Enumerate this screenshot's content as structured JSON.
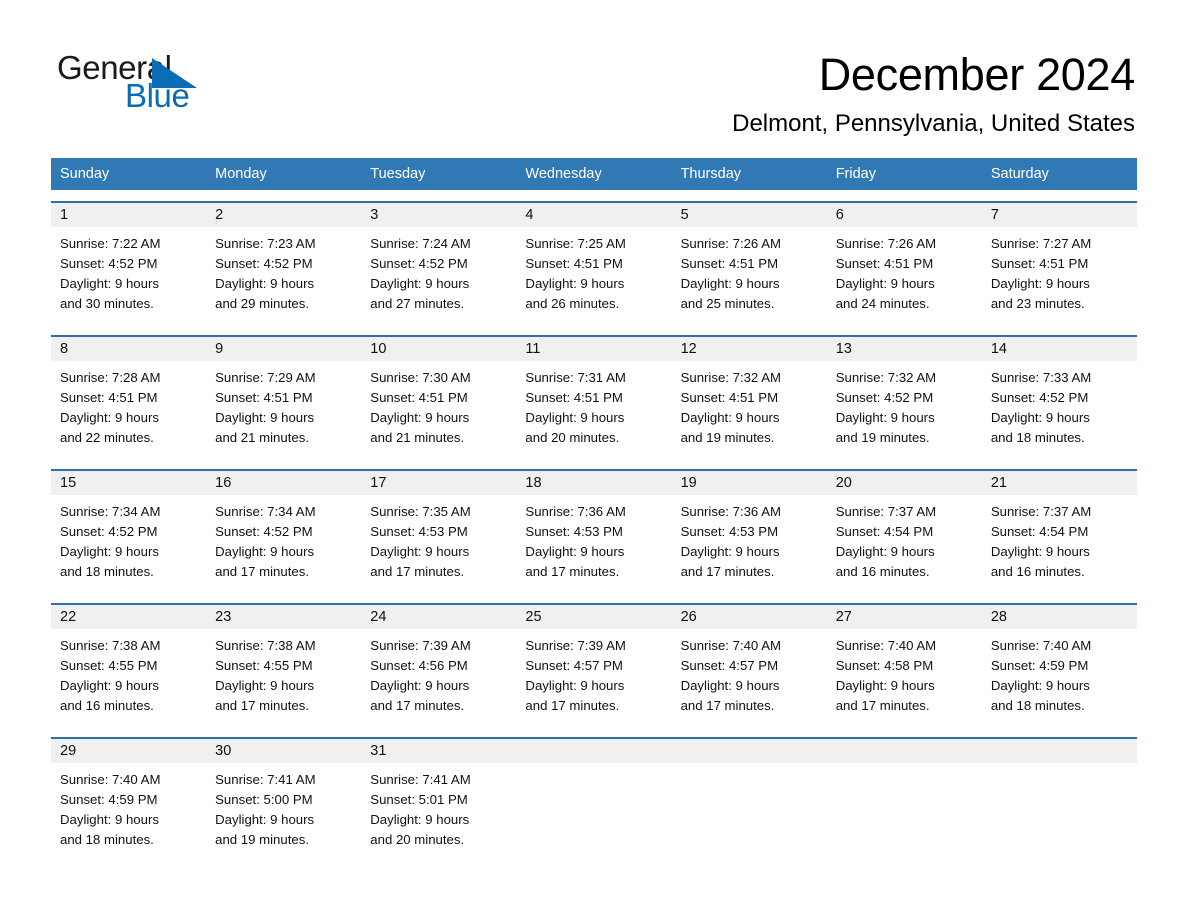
{
  "logo": {
    "word_top": "General",
    "word_bottom": "Blue",
    "triangle_color": "#0a6cb4"
  },
  "header": {
    "month_title": "December 2024",
    "location": "Delmont, Pennsylvania, United States"
  },
  "theme": {
    "header_blue": "#3179b5",
    "row_rule_blue": "#2f6fad",
    "date_band_gray": "#f0f0f0"
  },
  "weekdays": [
    "Sunday",
    "Monday",
    "Tuesday",
    "Wednesday",
    "Thursday",
    "Friday",
    "Saturday"
  ],
  "weeks": [
    {
      "days": [
        {
          "num": "1",
          "sunrise": "Sunrise: 7:22 AM",
          "sunset": "Sunset: 4:52 PM",
          "daylight1": "Daylight: 9 hours",
          "daylight2": "and 30 minutes."
        },
        {
          "num": "2",
          "sunrise": "Sunrise: 7:23 AM",
          "sunset": "Sunset: 4:52 PM",
          "daylight1": "Daylight: 9 hours",
          "daylight2": "and 29 minutes."
        },
        {
          "num": "3",
          "sunrise": "Sunrise: 7:24 AM",
          "sunset": "Sunset: 4:52 PM",
          "daylight1": "Daylight: 9 hours",
          "daylight2": "and 27 minutes."
        },
        {
          "num": "4",
          "sunrise": "Sunrise: 7:25 AM",
          "sunset": "Sunset: 4:51 PM",
          "daylight1": "Daylight: 9 hours",
          "daylight2": "and 26 minutes."
        },
        {
          "num": "5",
          "sunrise": "Sunrise: 7:26 AM",
          "sunset": "Sunset: 4:51 PM",
          "daylight1": "Daylight: 9 hours",
          "daylight2": "and 25 minutes."
        },
        {
          "num": "6",
          "sunrise": "Sunrise: 7:26 AM",
          "sunset": "Sunset: 4:51 PM",
          "daylight1": "Daylight: 9 hours",
          "daylight2": "and 24 minutes."
        },
        {
          "num": "7",
          "sunrise": "Sunrise: 7:27 AM",
          "sunset": "Sunset: 4:51 PM",
          "daylight1": "Daylight: 9 hours",
          "daylight2": "and 23 minutes."
        }
      ]
    },
    {
      "days": [
        {
          "num": "8",
          "sunrise": "Sunrise: 7:28 AM",
          "sunset": "Sunset: 4:51 PM",
          "daylight1": "Daylight: 9 hours",
          "daylight2": "and 22 minutes."
        },
        {
          "num": "9",
          "sunrise": "Sunrise: 7:29 AM",
          "sunset": "Sunset: 4:51 PM",
          "daylight1": "Daylight: 9 hours",
          "daylight2": "and 21 minutes."
        },
        {
          "num": "10",
          "sunrise": "Sunrise: 7:30 AM",
          "sunset": "Sunset: 4:51 PM",
          "daylight1": "Daylight: 9 hours",
          "daylight2": "and 21 minutes."
        },
        {
          "num": "11",
          "sunrise": "Sunrise: 7:31 AM",
          "sunset": "Sunset: 4:51 PM",
          "daylight1": "Daylight: 9 hours",
          "daylight2": "and 20 minutes."
        },
        {
          "num": "12",
          "sunrise": "Sunrise: 7:32 AM",
          "sunset": "Sunset: 4:51 PM",
          "daylight1": "Daylight: 9 hours",
          "daylight2": "and 19 minutes."
        },
        {
          "num": "13",
          "sunrise": "Sunrise: 7:32 AM",
          "sunset": "Sunset: 4:52 PM",
          "daylight1": "Daylight: 9 hours",
          "daylight2": "and 19 minutes."
        },
        {
          "num": "14",
          "sunrise": "Sunrise: 7:33 AM",
          "sunset": "Sunset: 4:52 PM",
          "daylight1": "Daylight: 9 hours",
          "daylight2": "and 18 minutes."
        }
      ]
    },
    {
      "days": [
        {
          "num": "15",
          "sunrise": "Sunrise: 7:34 AM",
          "sunset": "Sunset: 4:52 PM",
          "daylight1": "Daylight: 9 hours",
          "daylight2": "and 18 minutes."
        },
        {
          "num": "16",
          "sunrise": "Sunrise: 7:34 AM",
          "sunset": "Sunset: 4:52 PM",
          "daylight1": "Daylight: 9 hours",
          "daylight2": "and 17 minutes."
        },
        {
          "num": "17",
          "sunrise": "Sunrise: 7:35 AM",
          "sunset": "Sunset: 4:53 PM",
          "daylight1": "Daylight: 9 hours",
          "daylight2": "and 17 minutes."
        },
        {
          "num": "18",
          "sunrise": "Sunrise: 7:36 AM",
          "sunset": "Sunset: 4:53 PM",
          "daylight1": "Daylight: 9 hours",
          "daylight2": "and 17 minutes."
        },
        {
          "num": "19",
          "sunrise": "Sunrise: 7:36 AM",
          "sunset": "Sunset: 4:53 PM",
          "daylight1": "Daylight: 9 hours",
          "daylight2": "and 17 minutes."
        },
        {
          "num": "20",
          "sunrise": "Sunrise: 7:37 AM",
          "sunset": "Sunset: 4:54 PM",
          "daylight1": "Daylight: 9 hours",
          "daylight2": "and 16 minutes."
        },
        {
          "num": "21",
          "sunrise": "Sunrise: 7:37 AM",
          "sunset": "Sunset: 4:54 PM",
          "daylight1": "Daylight: 9 hours",
          "daylight2": "and 16 minutes."
        }
      ]
    },
    {
      "days": [
        {
          "num": "22",
          "sunrise": "Sunrise: 7:38 AM",
          "sunset": "Sunset: 4:55 PM",
          "daylight1": "Daylight: 9 hours",
          "daylight2": "and 16 minutes."
        },
        {
          "num": "23",
          "sunrise": "Sunrise: 7:38 AM",
          "sunset": "Sunset: 4:55 PM",
          "daylight1": "Daylight: 9 hours",
          "daylight2": "and 17 minutes."
        },
        {
          "num": "24",
          "sunrise": "Sunrise: 7:39 AM",
          "sunset": "Sunset: 4:56 PM",
          "daylight1": "Daylight: 9 hours",
          "daylight2": "and 17 minutes."
        },
        {
          "num": "25",
          "sunrise": "Sunrise: 7:39 AM",
          "sunset": "Sunset: 4:57 PM",
          "daylight1": "Daylight: 9 hours",
          "daylight2": "and 17 minutes."
        },
        {
          "num": "26",
          "sunrise": "Sunrise: 7:40 AM",
          "sunset": "Sunset: 4:57 PM",
          "daylight1": "Daylight: 9 hours",
          "daylight2": "and 17 minutes."
        },
        {
          "num": "27",
          "sunrise": "Sunrise: 7:40 AM",
          "sunset": "Sunset: 4:58 PM",
          "daylight1": "Daylight: 9 hours",
          "daylight2": "and 17 minutes."
        },
        {
          "num": "28",
          "sunrise": "Sunrise: 7:40 AM",
          "sunset": "Sunset: 4:59 PM",
          "daylight1": "Daylight: 9 hours",
          "daylight2": "and 18 minutes."
        }
      ]
    },
    {
      "days": [
        {
          "num": "29",
          "sunrise": "Sunrise: 7:40 AM",
          "sunset": "Sunset: 4:59 PM",
          "daylight1": "Daylight: 9 hours",
          "daylight2": "and 18 minutes."
        },
        {
          "num": "30",
          "sunrise": "Sunrise: 7:41 AM",
          "sunset": "Sunset: 5:00 PM",
          "daylight1": "Daylight: 9 hours",
          "daylight2": "and 19 minutes."
        },
        {
          "num": "31",
          "sunrise": "Sunrise: 7:41 AM",
          "sunset": "Sunset: 5:01 PM",
          "daylight1": "Daylight: 9 hours",
          "daylight2": "and 20 minutes."
        },
        {
          "num": "",
          "sunrise": "",
          "sunset": "",
          "daylight1": "",
          "daylight2": ""
        },
        {
          "num": "",
          "sunrise": "",
          "sunset": "",
          "daylight1": "",
          "daylight2": ""
        },
        {
          "num": "",
          "sunrise": "",
          "sunset": "",
          "daylight1": "",
          "daylight2": ""
        },
        {
          "num": "",
          "sunrise": "",
          "sunset": "",
          "daylight1": "",
          "daylight2": ""
        }
      ]
    }
  ]
}
